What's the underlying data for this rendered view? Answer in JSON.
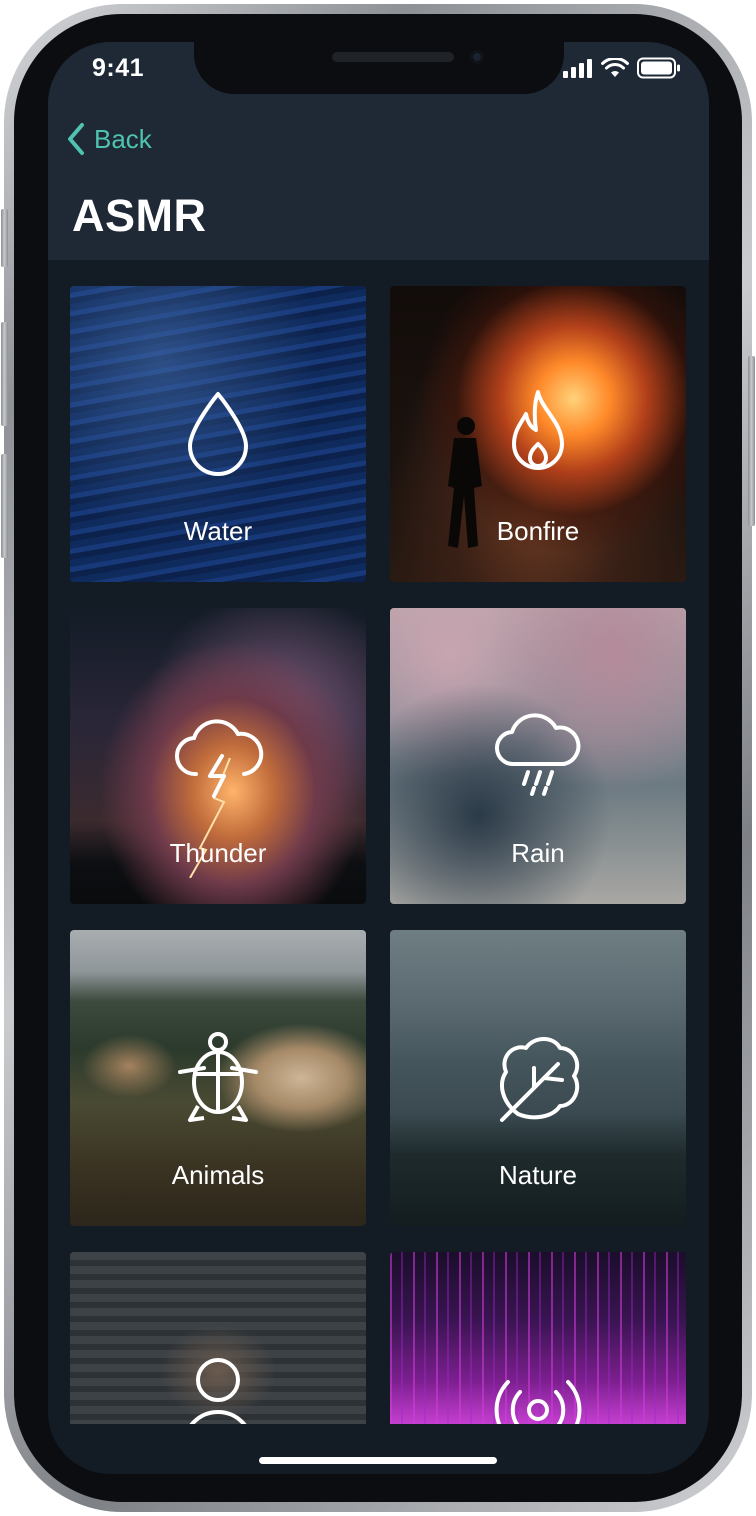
{
  "status_bar": {
    "time": "9:41"
  },
  "nav": {
    "back_label": "Back"
  },
  "page": {
    "title": "ASMR"
  },
  "tiles": [
    {
      "label": "Water",
      "icon": "water-drop-icon"
    },
    {
      "label": "Bonfire",
      "icon": "flame-icon"
    },
    {
      "label": "Thunder",
      "icon": "thunder-cloud-icon"
    },
    {
      "label": "Rain",
      "icon": "rain-cloud-icon"
    },
    {
      "label": "Animals",
      "icon": "turtle-icon"
    },
    {
      "label": "Nature",
      "icon": "leaf-icon"
    },
    {
      "label": "",
      "icon": "person-icon"
    },
    {
      "label": "",
      "icon": "broadcast-icon"
    }
  ],
  "colors": {
    "accent": "#4fc3b0",
    "header": "#1e2935",
    "background": "#131c25"
  }
}
